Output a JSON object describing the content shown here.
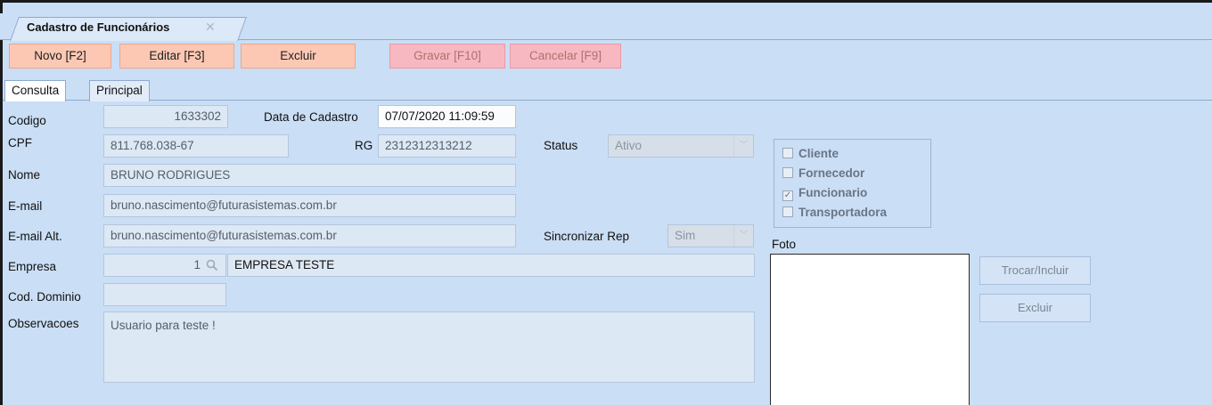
{
  "window": {
    "tab_title": "Cadastro de Funcionários",
    "close_glyph": "✕"
  },
  "toolbar": {
    "novo": "Novo [F2]",
    "editar": "Editar [F3]",
    "excluir": "Excluir",
    "gravar": "Gravar [F10]",
    "cancelar": "Cancelar [F9]"
  },
  "subtabs": {
    "consulta": "Consulta",
    "principal": "Principal"
  },
  "form": {
    "codigo_label": "Codigo",
    "codigo_value": "1633302",
    "data_cadastro_label": "Data de Cadastro",
    "data_cadastro_value": "07/07/2020 11:09:59",
    "cpf_label": "CPF",
    "cpf_value": "811.768.038-67",
    "rg_label": "RG",
    "rg_value": "2312312313212",
    "status_label": "Status",
    "status_value": "Ativo",
    "nome_label": "Nome",
    "nome_value": "BRUNO RODRIGUES",
    "email_label": "E-mail",
    "email_value": "bruno.nascimento@futurasistemas.com.br",
    "email_alt_label": "E-mail Alt.",
    "email_alt_value": "bruno.nascimento@futurasistemas.com.br",
    "sincronizar_label": "Sincronizar Rep",
    "sincronizar_value": "Sim",
    "empresa_label": "Empresa",
    "empresa_code": "1",
    "empresa_name": "EMPRESA TESTE",
    "cod_dominio_label": "Cod. Dominio",
    "cod_dominio_value": "",
    "observacoes_label": "Observacoes",
    "observacoes_value": "Usuario para teste !"
  },
  "tipo": {
    "cliente": "Cliente",
    "cliente_checked": false,
    "fornecedor": "Fornecedor",
    "fornecedor_checked": false,
    "funcionario": "Funcionario",
    "funcionario_checked": true,
    "transportadora": "Transportadora",
    "transportadora_checked": false
  },
  "foto": {
    "label": "Foto",
    "trocar": "Trocar/Incluir",
    "excluir": "Excluir"
  },
  "icons": {
    "search": "search-icon",
    "dropdown": "chevron-down-icon",
    "check": "check-icon"
  }
}
